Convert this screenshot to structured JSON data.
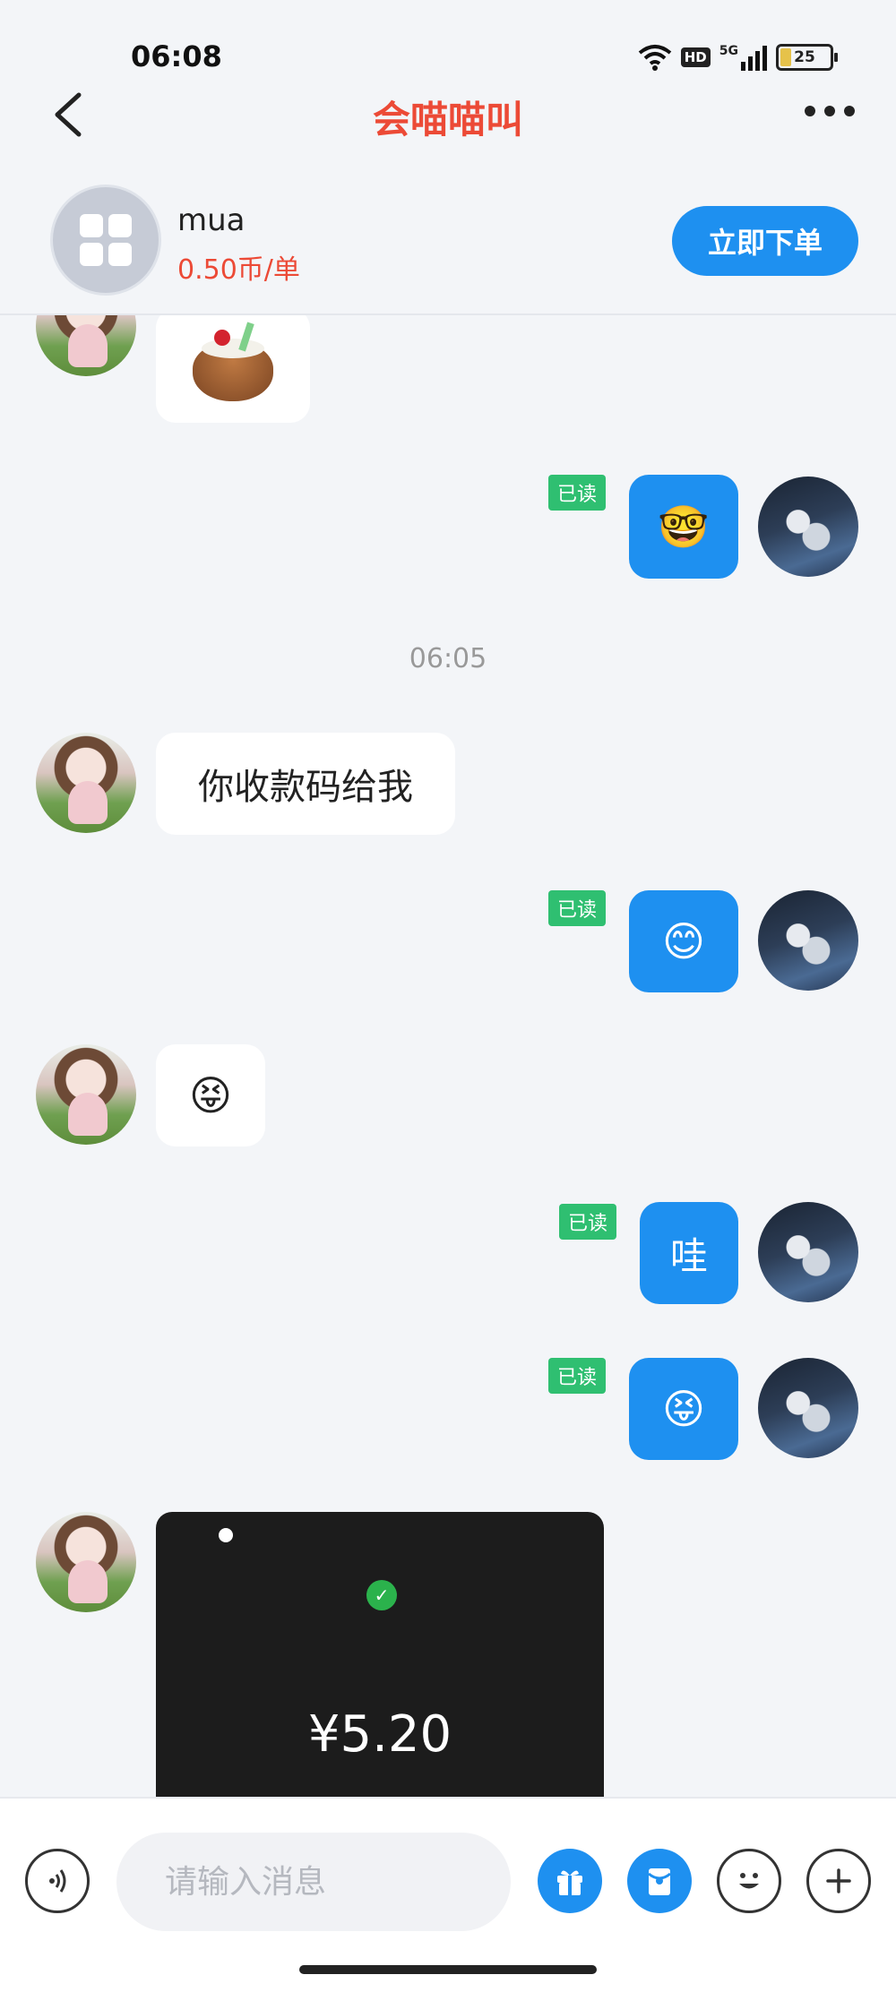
{
  "status_bar": {
    "time": "06:08",
    "hd_label": "HD",
    "network": "5G",
    "battery": "25"
  },
  "header": {
    "title": "会喵喵叫",
    "back_icon": "chevron-left-icon",
    "more_icon": "more-horizontal-icon"
  },
  "product": {
    "name": "mua",
    "price": "0.50币/单",
    "order_button": "立即下单",
    "icon": "grid-apps-icon"
  },
  "chat": {
    "timestamp": "06:05",
    "read_label": "已读",
    "messages": [
      {
        "side": "in",
        "type": "sticker",
        "sticker": "coconut-sticker"
      },
      {
        "side": "out",
        "type": "emoji",
        "text": "🤓",
        "read": "已读"
      },
      {
        "side": "in",
        "type": "text",
        "text": "你收款码给我"
      },
      {
        "side": "out",
        "type": "emoji",
        "text": "😊",
        "read": "已读"
      },
      {
        "side": "in",
        "type": "emoji",
        "text": "😝"
      },
      {
        "side": "out",
        "type": "text",
        "text": "哇",
        "read": "已读"
      },
      {
        "side": "out",
        "type": "emoji",
        "text": "😝",
        "read": "已读"
      },
      {
        "side": "in",
        "type": "image",
        "image": "payment-qr-screenshot",
        "amount": "¥5.20"
      }
    ]
  },
  "input_bar": {
    "placeholder": "请输入消息",
    "voice_icon": "voice-icon",
    "gift_icon": "gift-icon",
    "redpacket_icon": "red-packet-icon",
    "emoji_icon": "emoji-icon",
    "plus_icon": "plus-icon"
  },
  "colors": {
    "accent_blue": "#1e90f0",
    "title_red": "#ec4a36",
    "read_green": "#2fbf71",
    "background": "#f3f5f8"
  }
}
